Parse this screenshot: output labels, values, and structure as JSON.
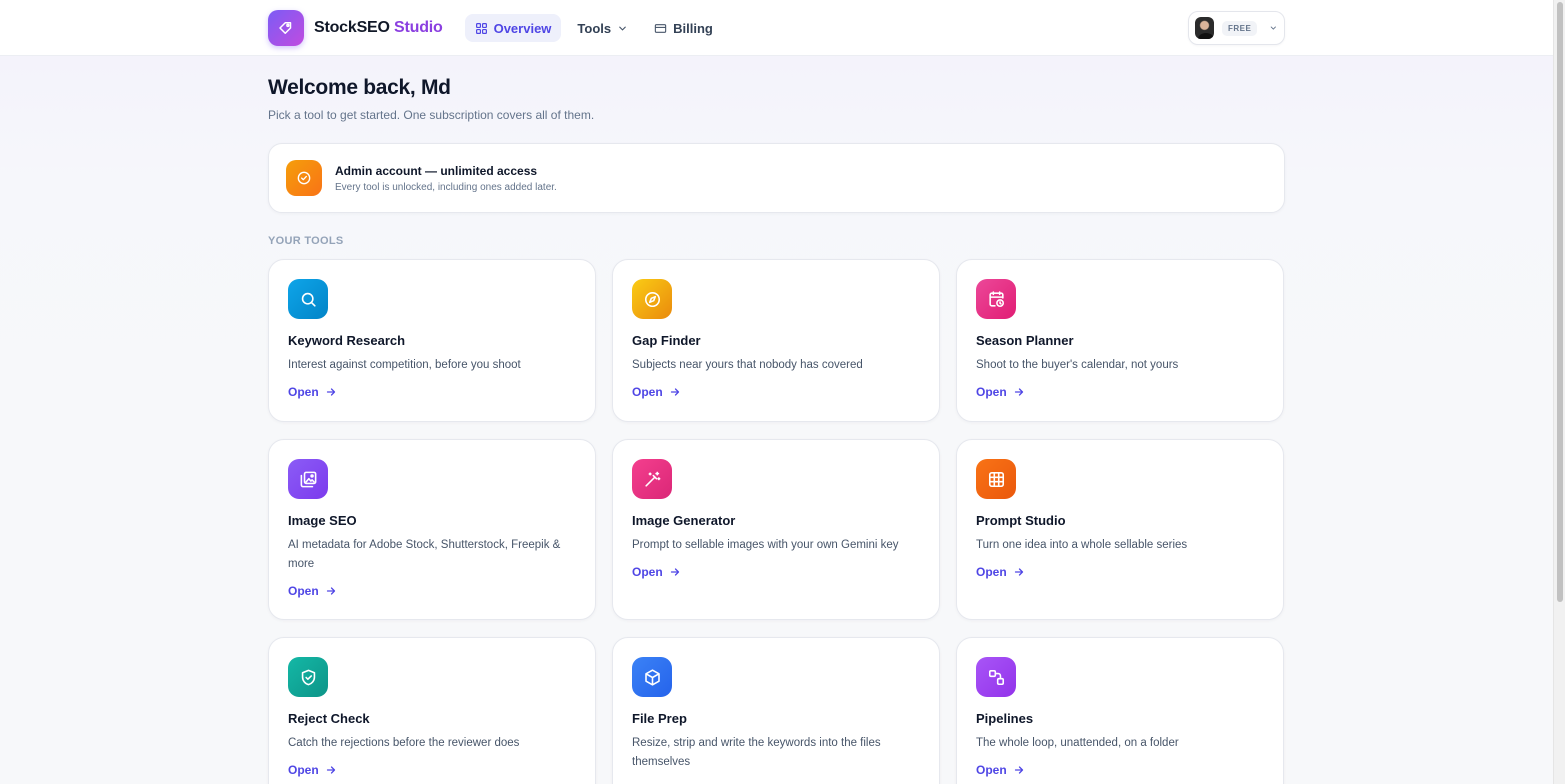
{
  "header": {
    "brand_main": "StockSEO",
    "brand_accent": "Studio",
    "nav": {
      "overview": "Overview",
      "tools": "Tools",
      "billing": "Billing"
    },
    "account": {
      "plan": "FREE"
    }
  },
  "main": {
    "title": "Welcome back, Md",
    "subtitle": "Pick a tool to get started. One subscription covers all of them.",
    "admin": {
      "title": "Admin account — unlimited access",
      "desc": "Every tool is unlocked, including ones added later."
    },
    "section_label": "YOUR TOOLS",
    "open_label": "Open",
    "tools": [
      {
        "name": "Keyword Research",
        "desc": "Interest against competition, before you shoot",
        "icon": "search-icon",
        "color": "#0ea5e9"
      },
      {
        "name": "Gap Finder",
        "desc": "Subjects near yours that nobody has covered",
        "icon": "compass-icon",
        "color": "#eab308"
      },
      {
        "name": "Season Planner",
        "desc": "Shoot to the buyer's calendar, not yours",
        "icon": "calendar-clock-icon",
        "color": "#ec4899"
      },
      {
        "name": "Image SEO",
        "desc": "AI metadata for Adobe Stock, Shutterstock, Freepik & more",
        "icon": "image-tag-icon",
        "color": "#8b5cf6"
      },
      {
        "name": "Image Generator",
        "desc": "Prompt to sellable images with your own Gemini key",
        "icon": "magic-wand-icon",
        "color": "#ec4899"
      },
      {
        "name": "Prompt Studio",
        "desc": "Turn one idea into a whole sellable series",
        "icon": "grid-icon",
        "color": "#f97316"
      },
      {
        "name": "Reject Check",
        "desc": "Catch the rejections before the reviewer does",
        "icon": "shield-check-icon",
        "color": "#14b8a6"
      },
      {
        "name": "File Prep",
        "desc": "Resize, strip and write the keywords into the files themselves",
        "icon": "box-icon",
        "color": "#3b82f6"
      },
      {
        "name": "Pipelines",
        "desc": "The whole loop, unattended, on a folder",
        "icon": "workflow-icon",
        "color": "#a855f7"
      }
    ]
  }
}
